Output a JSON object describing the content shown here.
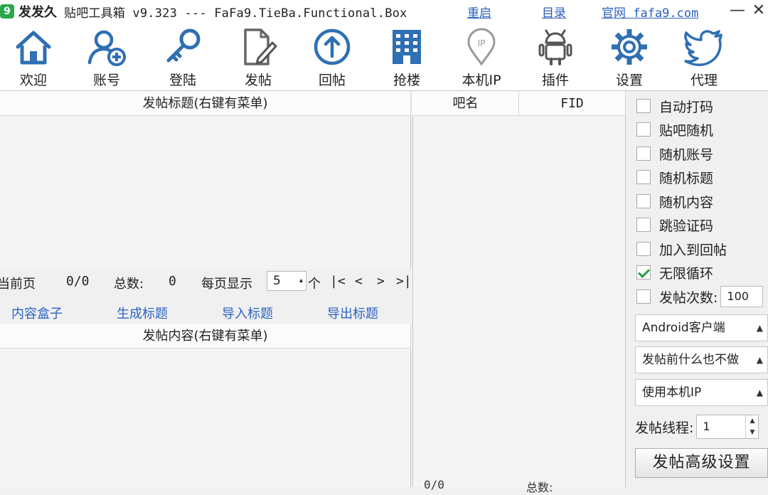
{
  "window": {
    "app_name": "发发久",
    "title": "贴吧工具箱 v9.323 --- FaFa9.TieBa.Functional.Box",
    "links": {
      "restart": "重启",
      "catalog": "目录",
      "website": "官网 fafa9.com"
    },
    "minimize": "—",
    "close": "✕"
  },
  "toolbar": [
    {
      "label": "欢迎",
      "icon": "home-icon"
    },
    {
      "label": "账号",
      "icon": "user-add-icon"
    },
    {
      "label": "登陆",
      "icon": "key-icon"
    },
    {
      "label": "发帖",
      "icon": "edit-document-icon"
    },
    {
      "label": "回帖",
      "icon": "upload-arrow-icon"
    },
    {
      "label": "抢楼",
      "icon": "building-icon"
    },
    {
      "label": "本机IP",
      "icon": "ip-pin-icon"
    },
    {
      "label": "插件",
      "icon": "android-icon"
    },
    {
      "label": "设置",
      "icon": "gear-icon"
    },
    {
      "label": "代理",
      "icon": "twitter-bird-icon"
    }
  ],
  "title_list": {
    "header": "发帖标题(右键有菜单)"
  },
  "pager": {
    "current_label": "当前页",
    "current_value": "0/0",
    "total_label": "总数:",
    "total_value": "0",
    "per_page_label": "每页显示",
    "per_page_value": "5",
    "unit": "个",
    "first": "|<",
    "prev": "<",
    "next": ">",
    "last": ">|"
  },
  "title_actions": {
    "content_box": "内容盒子",
    "generate_title": "生成标题",
    "import_title": "导入标题",
    "export_title": "导出标题"
  },
  "content_list": {
    "header": "发帖内容(右键有菜单)"
  },
  "forum_table": {
    "columns": [
      "吧名",
      "FID"
    ],
    "footer_count": "0/0",
    "footer_total_label": "总数:"
  },
  "options": {
    "checkboxes": [
      {
        "label": "自动打码",
        "checked": false
      },
      {
        "label": "贴吧随机",
        "checked": false
      },
      {
        "label": "随机账号",
        "checked": false
      },
      {
        "label": "随机标题",
        "checked": false
      },
      {
        "label": "随机内容",
        "checked": false
      },
      {
        "label": "跳验证码",
        "checked": false
      },
      {
        "label": "加入到回帖",
        "checked": false
      },
      {
        "label": "无限循环",
        "checked": true
      }
    ],
    "post_count": {
      "label": "发帖次数:",
      "value": "100",
      "checked": false
    },
    "client_select": "Android客户端",
    "before_post_select": "发帖前什么也不做",
    "ip_select": "使用本机IP",
    "threads": {
      "label": "发帖线程:",
      "value": "1"
    },
    "advanced_button": "发帖高级设置"
  },
  "colors": {
    "accent_blue": "#2b62c2",
    "check_green": "#27a048",
    "icon_blue": "#2f6fb3"
  }
}
